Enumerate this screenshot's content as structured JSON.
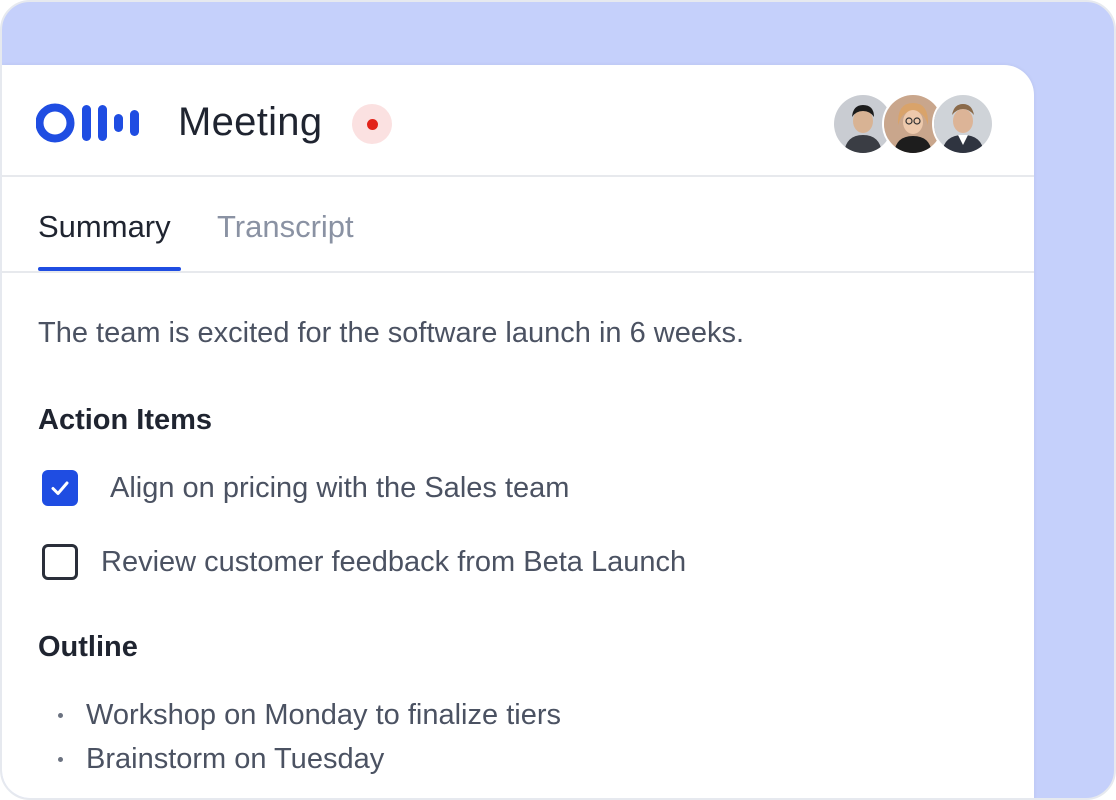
{
  "header": {
    "title": "Meeting",
    "logo_icon": "otter-logo-icon",
    "recording_indicator": "recording-dot-icon",
    "participants": [
      {
        "name": "participant-1",
        "icon": "avatar"
      },
      {
        "name": "participant-2",
        "icon": "avatar"
      },
      {
        "name": "participant-3",
        "icon": "avatar"
      }
    ]
  },
  "tabs": [
    {
      "label": "Summary",
      "active": true
    },
    {
      "label": "Transcript",
      "active": false
    }
  ],
  "summary": {
    "text": "The team is excited for the software launch in 6 weeks."
  },
  "action_items": {
    "heading": "Action Items",
    "items": [
      {
        "label": "Align on pricing with the Sales team",
        "checked": true
      },
      {
        "label": "Review customer feedback from Beta Launch",
        "checked": false
      }
    ]
  },
  "outline": {
    "heading": "Outline",
    "items": [
      {
        "label": "Workshop on Monday to finalize tiers"
      },
      {
        "label": "Brainstorm on Tuesday"
      }
    ]
  },
  "colors": {
    "brand": "#1f4de2",
    "background_panel": "#c5d0fb",
    "recording": "#e2231a",
    "recording_bg": "#fbe1e1",
    "text_primary": "#1f2430",
    "text_secondary": "#4b5262",
    "tab_inactive": "#8a92a3"
  }
}
